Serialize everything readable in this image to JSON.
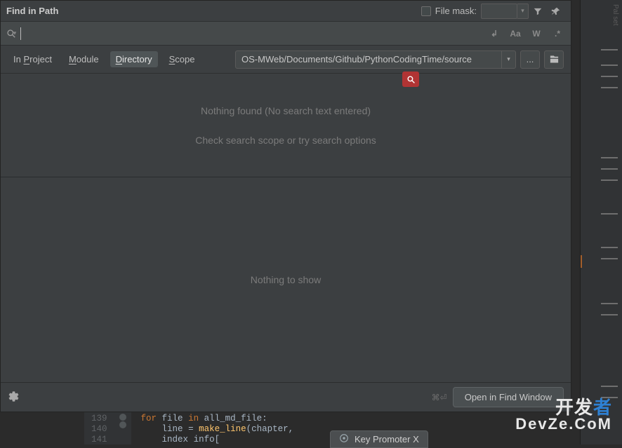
{
  "dialog": {
    "title": "Find in Path",
    "file_mask_label": "File mask:",
    "search_value": "",
    "options": {
      "newline": "↲",
      "case": "Aa",
      "words": "W",
      "regex": ".*"
    },
    "tabs": [
      {
        "id": "project",
        "label": "In Project",
        "mnemonic": "P"
      },
      {
        "id": "module",
        "label": "Module",
        "mnemonic": "M"
      },
      {
        "id": "directory",
        "label": "Directory",
        "mnemonic": "D",
        "selected": true
      },
      {
        "id": "scope",
        "label": "Scope",
        "mnemonic": "S"
      }
    ],
    "path_value": "OS-MWeb/Documents/Github/PythonCodingTime/source",
    "browse_label": "...",
    "msg_nothing_found": "Nothing found (No search text entered)",
    "msg_check_scope": "Check search scope or try search options",
    "msg_nothing_to_show": "Nothing to show",
    "shortcut_hint": "⌘⏎",
    "open_button": "Open in Find Window"
  },
  "code": {
    "lines": [
      {
        "num": "139",
        "html": "<span class='kw'>for</span> <span class='id'>file</span> <span class='kw'>in</span> <span class='id'>all_md_file</span><span class='punct'>:</span>"
      },
      {
        "num": "140",
        "html": "    <span class='id'>line</span> <span class='op'>=</span> <span class='fn'>make_line</span><span class='punct'>(</span><span class='id'>chapter</span><span class='punct'>,</span>"
      },
      {
        "num": "141",
        "html": "    <span class='id'>index</span> <span class='id'>info</span><span class='punct'>[</span>"
      }
    ]
  },
  "promoter": {
    "label": "Key Promoter X"
  },
  "watermark": {
    "l1_pre": "开发",
    "l1_z": "者",
    "l2": "DevZe.CoM"
  }
}
